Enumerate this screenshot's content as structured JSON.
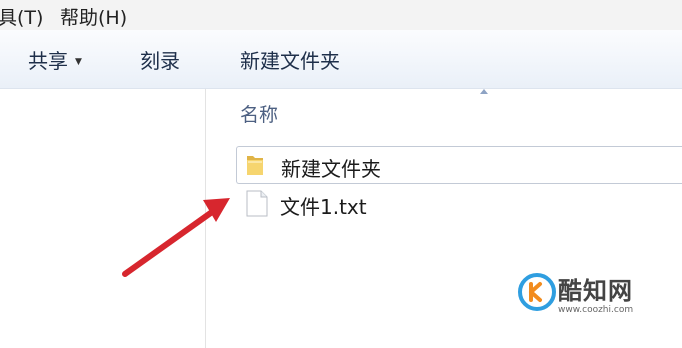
{
  "menubar": {
    "items": [
      {
        "label": "具(T)"
      },
      {
        "label": "帮助(H)"
      }
    ]
  },
  "toolbar": {
    "share_label": "共享",
    "burn_label": "刻录",
    "new_folder_label": "新建文件夹"
  },
  "file_list": {
    "column_header": "名称",
    "items": [
      {
        "name": "新建文件夹",
        "type": "folder",
        "icon": "folder-icon"
      },
      {
        "name": "文件1.txt",
        "type": "text-file",
        "icon": "text-file-icon"
      }
    ]
  },
  "annotation": {
    "color": "#d7262e"
  },
  "watermark": {
    "name": "酷知网",
    "url": "www.coozhi.com"
  }
}
